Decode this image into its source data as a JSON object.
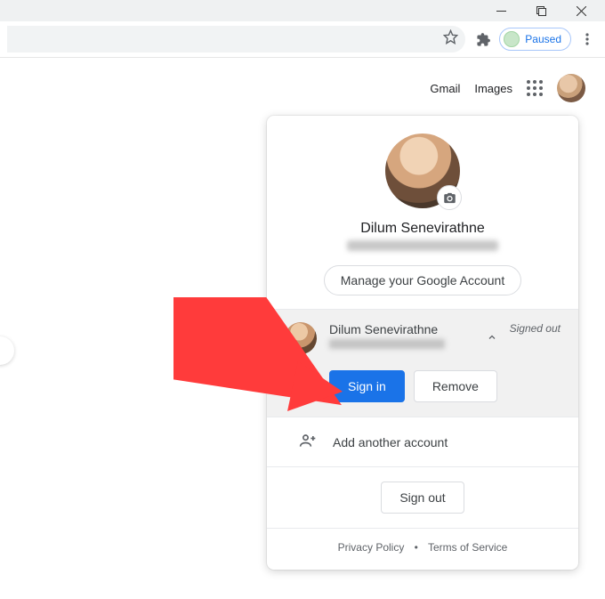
{
  "window": {
    "paused_label": "Paused"
  },
  "gnav": {
    "gmail": "Gmail",
    "images": "Images"
  },
  "popover": {
    "name": "Dilum Senevirathne",
    "manage_label": "Manage your Google Account",
    "account_row": {
      "name": "Dilum Senevirathne",
      "status": "Signed out",
      "signin_label": "Sign in",
      "remove_label": "Remove"
    },
    "add_label": "Add another account",
    "signout_label": "Sign out",
    "footer": {
      "privacy": "Privacy Policy",
      "terms": "Terms of Service"
    }
  }
}
